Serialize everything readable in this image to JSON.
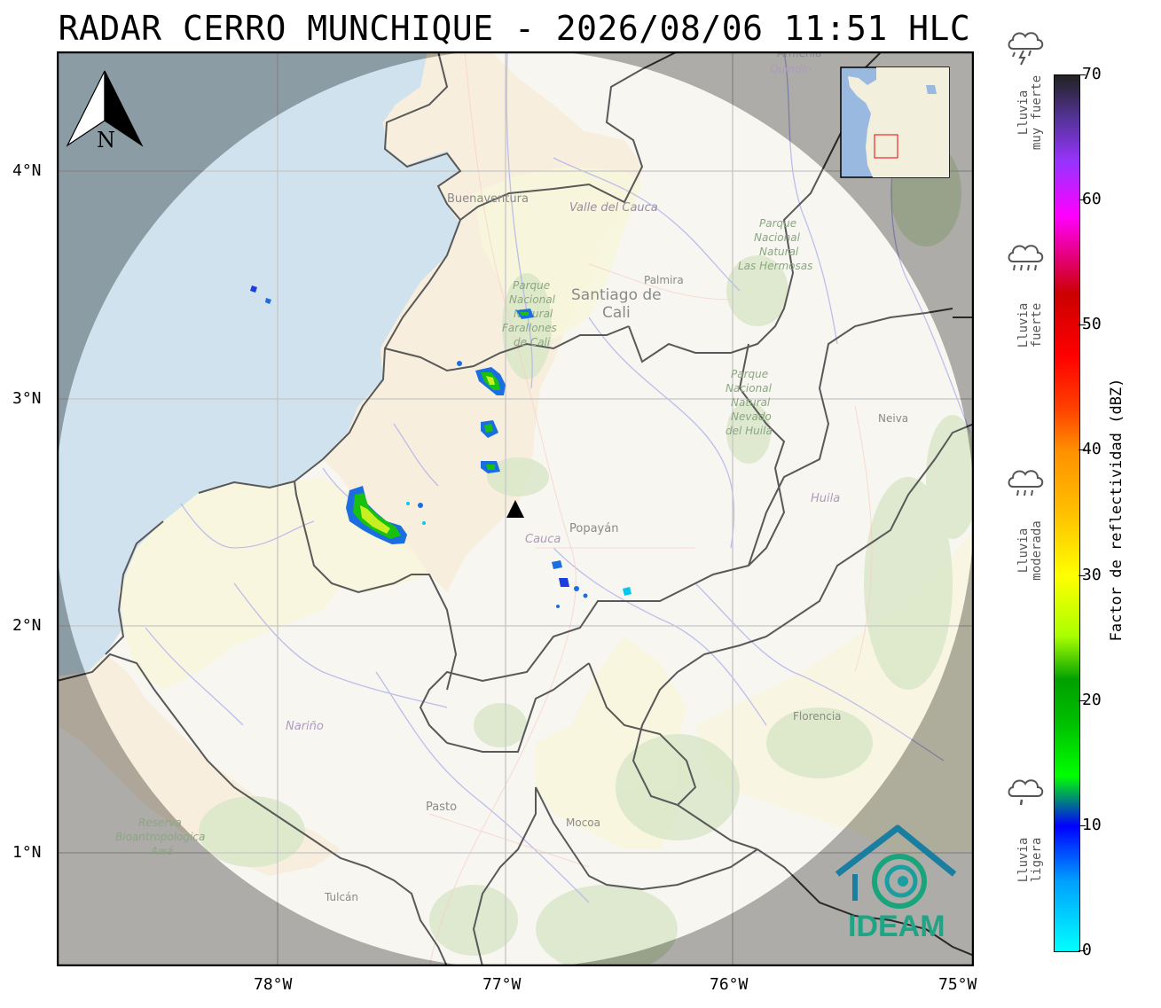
{
  "title": "RADAR CERRO MUNCHIQUE - 2026/08/06 11:51 HLC",
  "axes": {
    "x_ticks": [
      "78°W",
      "77°W",
      "76°W",
      "75°W"
    ],
    "y_ticks": [
      "4°N",
      "3°N",
      "2°N",
      "1°N"
    ]
  },
  "north_arrow": {
    "letter": "N"
  },
  "place_labels": {
    "buenaventura": "Buenaventura",
    "valle": "Valle del Cauca",
    "palmira": "Palmira",
    "cali_1": "Santiago de",
    "cali_2": "Cali",
    "farallones_1": "Parque",
    "farallones_2": "Nacional",
    "farallones_3": "Natural",
    "farallones_4": "Farallones",
    "farallones_5": "de Cali",
    "hermosas_1": "Parque",
    "hermosas_2": "Nacional",
    "hermosas_3": "Natural",
    "hermosas_4": "Las Hermosas",
    "huila_park_1": "Parque",
    "huila_park_2": "Nacional",
    "huila_park_3": "Natural",
    "huila_park_4": "Nevado",
    "huila_park_5": "del Huila",
    "neiva": "Neiva",
    "huila": "Huila",
    "popayan": "Popayán",
    "cauca": "Cauca",
    "narino": "Nariño",
    "pasto": "Pasto",
    "mocoa": "Mocoa",
    "florencia": "Florencia",
    "tulcan": "Tulcán",
    "awa_1": "Reserva",
    "awa_2": "Bioantropologica",
    "awa_3": "Awá",
    "armenia": "Armenia",
    "quindio": "Quindío"
  },
  "logo_text": "IDEAM",
  "colorbar": {
    "title": "Factor de reflectividad (dBZ)",
    "ticks": [
      "0",
      "10",
      "20",
      "30",
      "40",
      "50",
      "60",
      "70"
    ],
    "range": [
      0,
      70
    ]
  },
  "rain_categories": [
    {
      "line1": "Lluvia",
      "line2": "muy fuerte",
      "dbz": 62,
      "icon": "storm-cloud-icon"
    },
    {
      "line1": "Lluvia",
      "line2": "fuerte",
      "dbz": 45,
      "icon": "heavy-rain-cloud-icon"
    },
    {
      "line1": "Lluvia",
      "line2": "moderada",
      "dbz": 27,
      "icon": "moderate-rain-cloud-icon"
    },
    {
      "line1": "Lluvia",
      "line2": "ligera",
      "dbz": 9,
      "icon": "light-rain-cloud-icon"
    }
  ],
  "colors": {
    "ocean": "#a9c5e2",
    "land": "#f3f1ea",
    "valle_fill": "#f5e3c8",
    "narino_fill": "#f3f2c9",
    "park_green": "#c8dcb0",
    "outside_radar": "#9c9c9c",
    "ideam_teal": "#2a9e8e",
    "radar_site": "#000000"
  }
}
